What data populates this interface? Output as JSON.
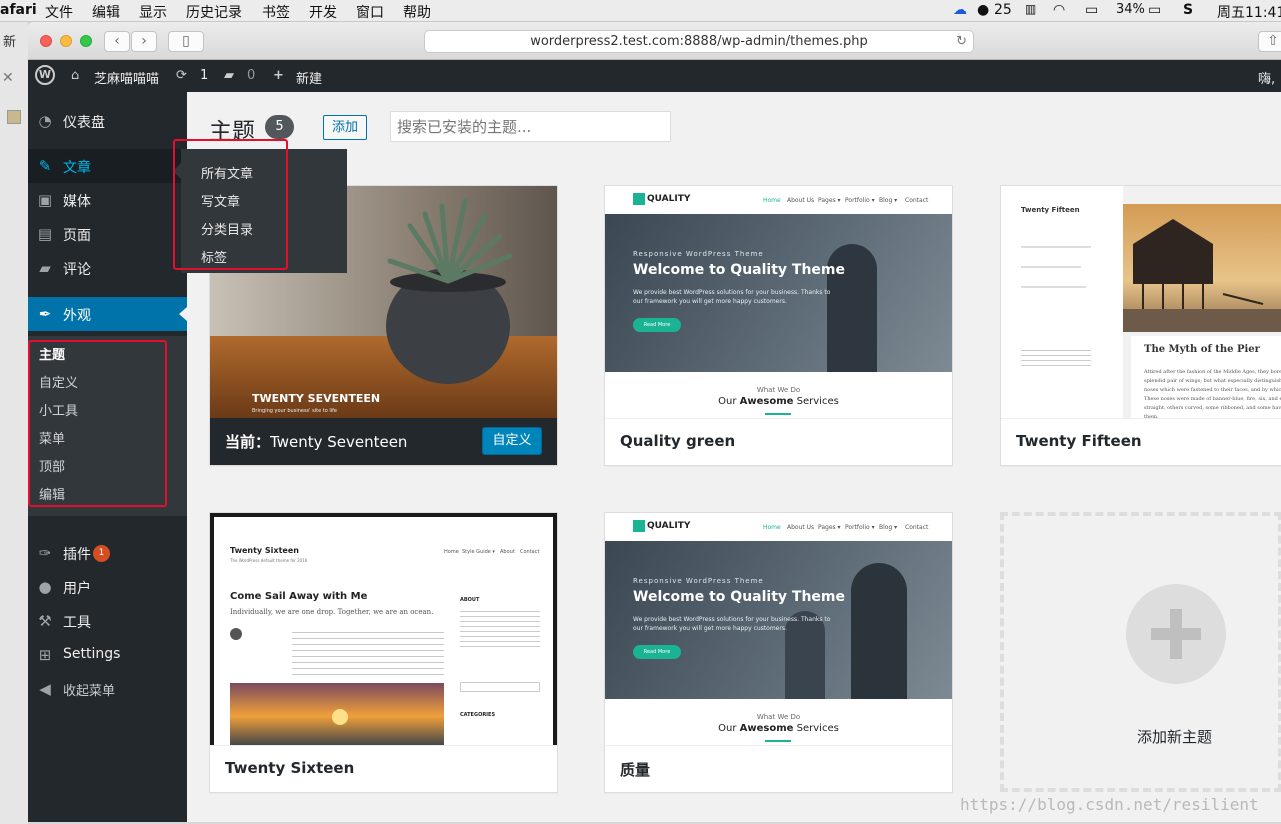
{
  "menubar": {
    "app": "afari",
    "items": [
      "文件",
      "编辑",
      "显示",
      "历史记录",
      "书签",
      "开发",
      "窗口",
      "帮助"
    ],
    "qq_count": "25",
    "battery": "34%",
    "clock": "周五11:41"
  },
  "browser": {
    "url": "worderpress2.test.com:8888/wp-admin/themes.php",
    "left_tab": "新"
  },
  "adminbar": {
    "site": "芝麻喵喵喵",
    "updates": "1",
    "comments": "0",
    "new": "新建",
    "greeting": "嗨,"
  },
  "sidebar": {
    "dashboard": "仪表盘",
    "posts": "文章",
    "media": "媒体",
    "pages": "页面",
    "comments": "评论",
    "appearance": "外观",
    "appearance_sub": [
      "主题",
      "自定义",
      "小工具",
      "菜单",
      "顶部",
      "编辑"
    ],
    "plugins": "插件",
    "plugins_badge": "1",
    "users": "用户",
    "tools": "工具",
    "settings": "Settings",
    "collapse": "收起菜单"
  },
  "posts_flyout": [
    "所有文章",
    "写文章",
    "分类目录",
    "标签"
  ],
  "page": {
    "title": "主题",
    "count": "5",
    "add": "添加",
    "search_placeholder": "搜索已安装的主题..."
  },
  "themes": {
    "current_prefix": "当前：",
    "current_name": "Twenty Seventeen",
    "customize": "自定义",
    "t1_overlay": "TWENTY SEVENTEEN",
    "t1_overlay_sub": "Bringing your business' site to life",
    "quality_green": "Quality green",
    "twenty_fifteen": "Twenty Fifteen",
    "twenty_sixteen": "Twenty Sixteen",
    "zhiliang": "质量",
    "add_new": "添加新主题"
  },
  "quality_mock": {
    "logo": "QUALITY",
    "nav": [
      "Home",
      "About Us",
      "Pages ▾",
      "Portfolio ▾",
      "Blog ▾",
      "Contact"
    ],
    "tag": "Responsive WordPress Theme",
    "headline": "Welcome to Quality Theme",
    "para": "We provide best WordPress solutions for your business. Thanks to our framework you will get more happy customers.",
    "btn": "Read More",
    "what": "What We Do",
    "services_pre": "Our ",
    "services_bold": "Awesome",
    "services_post": " Services"
  },
  "fifteen_mock": {
    "site": "Twenty Fifteen",
    "post_title": "The Myth of the Pier",
    "post_text": "Attired after the fashion of the Middle Ages, they bore upon their shoulders a splendid pair of wings; but what especially distinguished them was the long noses which were fastened to their faces, and by which they made of them. These noses were made of banner-blue, fire, six, and even ten feet long, some straight, others curved, some ribboned, and some having imitation warts upon them."
  },
  "sixteen_mock": {
    "site": "Twenty Sixteen",
    "tagline": "The WordPress default theme for 2016",
    "nav": [
      "Home",
      "Style Guide ▾",
      "About",
      "Contact"
    ],
    "post_title": "Come Sail Away with Me",
    "post_sub": "Individually, we are one drop. Together, we are an ocean.",
    "about": "ABOUT",
    "categories": "CATEGORIES"
  },
  "watermark": "https://blog.csdn.net/resilient"
}
